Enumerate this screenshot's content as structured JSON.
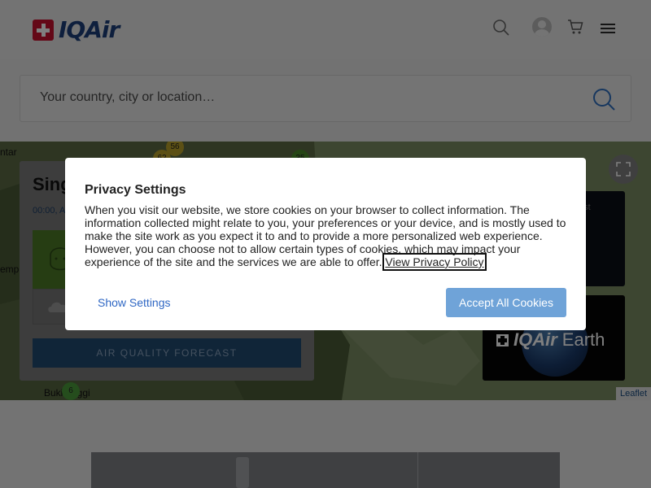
{
  "header": {
    "logo_text": "IQAir",
    "icons": [
      "search-icon",
      "user-avatar",
      "cart-icon",
      "menu-icon"
    ]
  },
  "search": {
    "placeholder": "Your country, city or location…"
  },
  "map": {
    "labels": {
      "left_top": "ntar",
      "left_mid": "emp",
      "bottom": "Bukit Siggi"
    },
    "markers": [
      "56",
      "62",
      "35",
      "6"
    ],
    "attribution": "Leaflet"
  },
  "city_card": {
    "name": "Sing",
    "time": "00:00, A",
    "forecast_button": "AIR QUALITY FORECAST"
  },
  "promo": {
    "text_top": "ost",
    "text_bottom": "ar"
  },
  "earth": {
    "brand": "IQAir",
    "word": "Earth"
  },
  "privacy": {
    "title": "Privacy Settings",
    "body": "When you visit our website, we store cookies on your browser to collect information. The information collected might relate to you, your preferences or your device, and is mostly used to make the site work as you expect it to and to provide a more personalized web experience. However, you can choose not to allow certain types of cookies, which may impact your experience of the site and the services we are able to offer.",
    "link": "View Privacy Policy",
    "show_settings": "Show Settings",
    "accept": "Accept All Cookies"
  },
  "colors": {
    "brand_red": "#c8102e",
    "brand_blue": "#1c3e7a",
    "accept_button": "#6fa3d8",
    "link_blue": "#2f67c4",
    "aqi_good": "#4c7a26"
  }
}
